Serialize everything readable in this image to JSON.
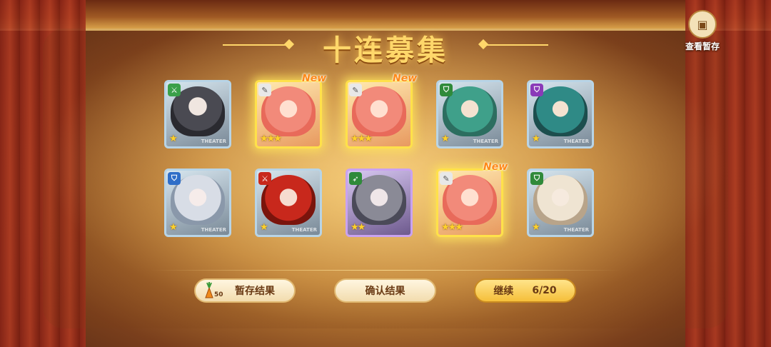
{
  "title": "十连募集",
  "storage": {
    "label": "查看暂存",
    "icon": "box-icon"
  },
  "cards": [
    {
      "rarity": 1,
      "stars": "★",
      "class_icon": "sword-icon",
      "class_color": "green",
      "portrait": "gray",
      "new": "",
      "watermark": "THEATER"
    },
    {
      "rarity": 3,
      "stars": "★★★",
      "class_icon": "staff-icon",
      "class_color": "gray",
      "portrait": "pink",
      "new": "New",
      "watermark": ""
    },
    {
      "rarity": 3,
      "stars": "★★★",
      "class_icon": "staff-icon",
      "class_color": "gray",
      "portrait": "pink",
      "new": "New",
      "watermark": ""
    },
    {
      "rarity": 1,
      "stars": "★",
      "class_icon": "shield-icon",
      "class_color": "dgreen",
      "portrait": "green",
      "new": "",
      "watermark": "THEATER"
    },
    {
      "rarity": 1,
      "stars": "★",
      "class_icon": "shield-icon",
      "class_color": "purple",
      "portrait": "teal",
      "new": "",
      "watermark": "THEATER"
    },
    {
      "rarity": 1,
      "stars": "★",
      "class_icon": "shield-icon",
      "class_color": "blue",
      "portrait": "white",
      "new": "",
      "watermark": "THEATER"
    },
    {
      "rarity": 1,
      "stars": "★",
      "class_icon": "sword-icon",
      "class_color": "red",
      "portrait": "red",
      "new": "",
      "watermark": "THEATER"
    },
    {
      "rarity": 2,
      "stars": "★★",
      "class_icon": "bow-icon",
      "class_color": "dgreen",
      "portrait": "silver",
      "new": "",
      "watermark": ""
    },
    {
      "rarity": 3,
      "stars": "★★★",
      "class_icon": "staff-icon",
      "class_color": "gray",
      "portrait": "pink",
      "new": "New",
      "watermark": ""
    },
    {
      "rarity": 1,
      "stars": "★",
      "class_icon": "shield-icon",
      "class_color": "dgreen",
      "portrait": "cream",
      "new": "",
      "watermark": "THEATER"
    }
  ],
  "buttons": {
    "save": {
      "label": "暂存结果",
      "cost": "50",
      "cost_icon": "carrot-icon"
    },
    "confirm": {
      "label": "确认结果"
    },
    "continue": {
      "label": "继续",
      "count": "6/20"
    }
  }
}
